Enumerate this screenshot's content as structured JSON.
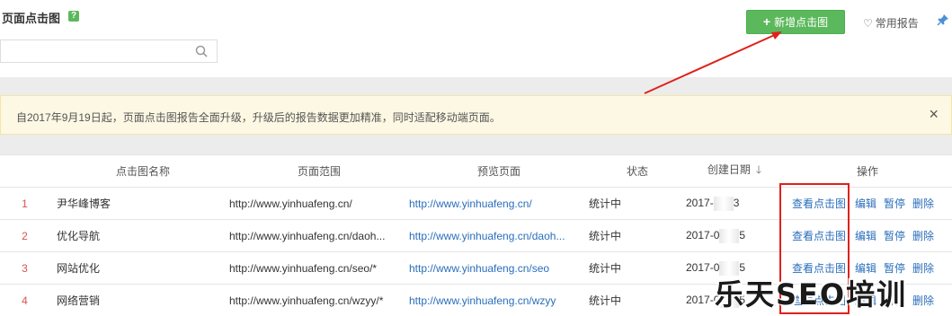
{
  "header": {
    "title": "页面点击图",
    "help_label": "?",
    "add_button": "新增点击图",
    "fav_link": "常用报告"
  },
  "search": {
    "placeholder": "",
    "value": ""
  },
  "notice": {
    "text": "自2017年9月19日起，页面点击图报告全面升级，升级后的报告数据更加精准，同时适配移动端页面。",
    "close": "×"
  },
  "table": {
    "columns": [
      "点击图名称",
      "页面范围",
      "预览页面",
      "状态",
      "创建日期",
      "操作"
    ],
    "rows": [
      {
        "idx": "1",
        "name": "尹华峰博客",
        "range": "http://www.yinhuafeng.cn/",
        "preview": "http://www.yinhuafeng.cn/",
        "status": "统计中",
        "date_start": "2017-",
        "date_end": "3"
      },
      {
        "idx": "2",
        "name": "优化导航",
        "range": "http://www.yinhuafeng.cn/daoh...",
        "preview": "http://www.yinhuafeng.cn/daoh...",
        "status": "统计中",
        "date_start": "2017-0",
        "date_end": "5"
      },
      {
        "idx": "3",
        "name": "网站优化",
        "range": "http://www.yinhuafeng.cn/seo/*",
        "preview": "http://www.yinhuafeng.cn/seo",
        "status": "统计中",
        "date_start": "2017-0",
        "date_end": "5"
      },
      {
        "idx": "4",
        "name": "网络营销",
        "range": "http://www.yinhuafeng.cn/wzyy/*",
        "preview": "http://www.yinhuafeng.cn/wzyy",
        "status": "统计中",
        "date_start": "2017-0",
        "date_end": "5"
      }
    ],
    "ops": {
      "view": "查看点击图",
      "edit": "编辑",
      "pause": "暂停",
      "delete": "删除"
    }
  },
  "watermark": "乐天SEO培训",
  "colors": {
    "accent_green": "#5cb85c",
    "link_blue": "#2a6ebb",
    "annotation_red": "#e0211b"
  }
}
